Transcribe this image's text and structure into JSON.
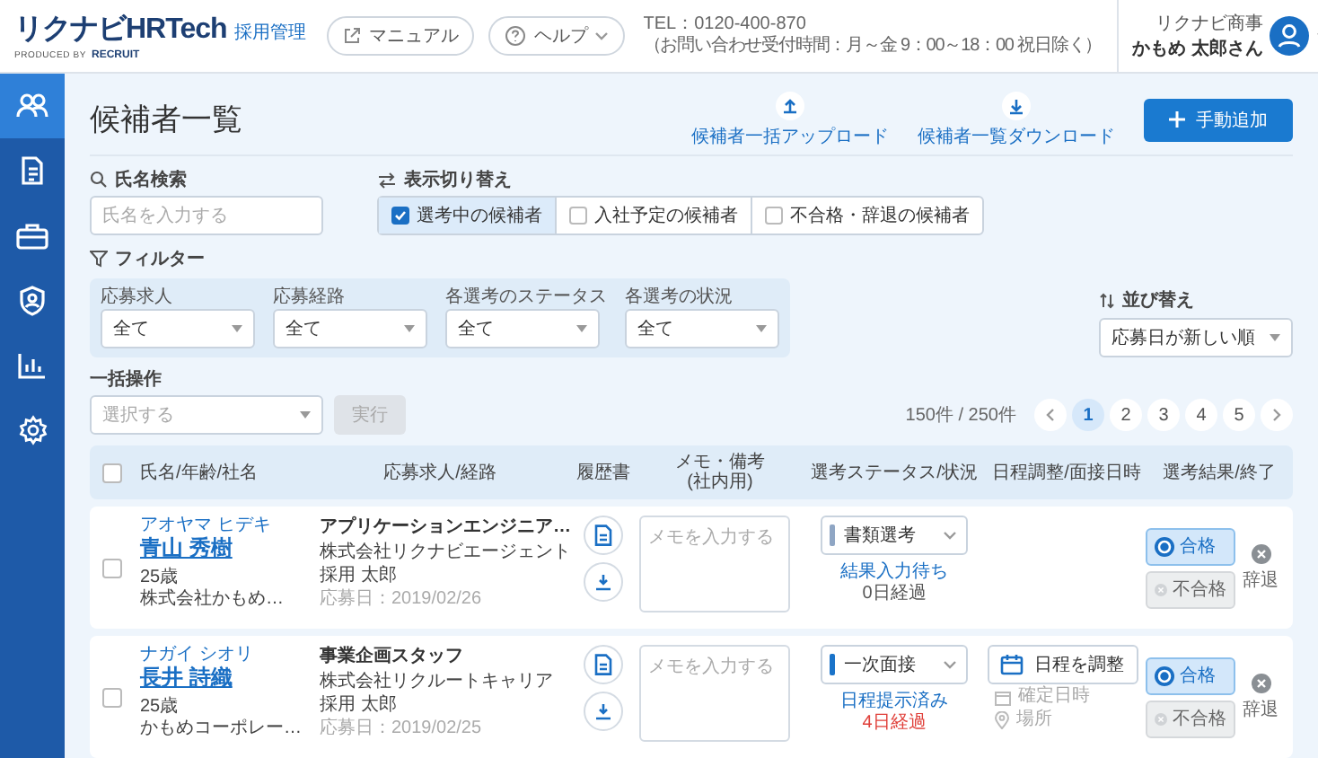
{
  "header": {
    "logo": "リクナビHRTech",
    "logo_sub": "採用管理",
    "produced_by": "PRODUCED BY",
    "brand": "RECRUIT",
    "buttons": [
      {
        "label": "マニュアル",
        "kind": "manual"
      },
      {
        "label": "ヘルプ",
        "kind": "help"
      }
    ],
    "tel": "TEL：0120-400-870",
    "hours": "（お問い合わせ受付時間：月～金 9：00～18：00 祝日除く）",
    "user": {
      "company": "リクナビ商事",
      "name": "かもめ 太郎さん"
    }
  },
  "sidebar": {
    "items": [
      {
        "kind": "people",
        "selected": true
      },
      {
        "kind": "document",
        "selected": false
      },
      {
        "kind": "briefcase",
        "selected": false
      },
      {
        "kind": "shield",
        "selected": false
      },
      {
        "kind": "chart",
        "selected": false
      },
      {
        "kind": "settings",
        "selected": false
      }
    ]
  },
  "page": {
    "title": "候補者一覧",
    "actions": [
      {
        "label": "候補者一括アップロード",
        "kind": "upload"
      },
      {
        "label": "候補者一覧ダウンロード",
        "kind": "download"
      }
    ],
    "add_button": "手動追加"
  },
  "search": {
    "label": "氏名検索",
    "placeholder": "氏名を入力する"
  },
  "view_toggle": {
    "label": "表示切り替え",
    "options": [
      {
        "label": "選考中の候補者",
        "checked": true
      },
      {
        "label": "入社予定の候補者",
        "checked": false
      },
      {
        "label": "不合格・辞退の候補者",
        "checked": false
      }
    ]
  },
  "filter": {
    "label": "フィルター",
    "fields": [
      {
        "label": "応募求人",
        "value": "全て"
      },
      {
        "label": "応募経路",
        "value": "全て"
      },
      {
        "label": "各選考のステータス",
        "value": "全て"
      },
      {
        "label": "各選考の状況",
        "value": "全て"
      }
    ]
  },
  "sort": {
    "label": "並び替え",
    "value": "応募日が新しい順"
  },
  "bulk": {
    "label": "一括操作",
    "placeholder": "選択する",
    "button": {
      "label": "実行",
      "disabled": true
    }
  },
  "count": "150件 / 250件",
  "pagination": {
    "pages": [
      {
        "label": "1",
        "selected": true
      },
      {
        "label": "2",
        "selected": false
      },
      {
        "label": "3",
        "selected": false
      },
      {
        "label": "4",
        "selected": false
      },
      {
        "label": "5",
        "selected": false
      }
    ]
  },
  "table": {
    "all_checked": false,
    "columns": [
      {
        "label": "氏名/年齢/社名"
      },
      {
        "label": "応募求人/経路"
      },
      {
        "label": "履歴書"
      },
      {
        "label": "メモ・備考",
        "sub": "(社内用)"
      },
      {
        "label": "選考ステータス/状況"
      },
      {
        "label": "日程調整/面接日時"
      },
      {
        "label": "選考結果/終了"
      }
    ],
    "rows": [
      {
        "kana": "アオヤマ ヒデキ",
        "name": "青山 秀樹",
        "age": "25歳",
        "company": "株式会社かもめ…",
        "job": "アプリケーションエンジニア…",
        "agency": "株式会社リクナビエージェント",
        "staff": "採用 太郎",
        "applied": "応募日：2019/02/26",
        "memo_placeholder": "メモを入力する",
        "stage": "書類選考",
        "color": "#8fa6c4",
        "checked": false,
        "status": "結果入力待ち",
        "elapsed": "0日経過",
        "overdue": false,
        "pass": "合格",
        "fail": "不合格",
        "withdraw": "辞退"
      },
      {
        "kana": "ナガイ シオリ",
        "name": "長井 詩織",
        "age": "25歳",
        "company": "かもめコーポレー…",
        "job": "事業企画スタッフ",
        "agency": "株式会社リクルートキャリア",
        "staff": "採用 太郎",
        "applied": "応募日：2019/02/25",
        "memo_placeholder": "メモを入力する",
        "stage": "一次面接",
        "color": "#1a73c9",
        "checked": false,
        "status": "日程提示済み",
        "elapsed": "4日経過",
        "overdue": true,
        "schedule": {
          "button": "日程を調整",
          "date": "確定日時",
          "place": "場所"
        },
        "pass": "合格",
        "fail": "不合格",
        "withdraw": "辞退"
      }
    ]
  }
}
